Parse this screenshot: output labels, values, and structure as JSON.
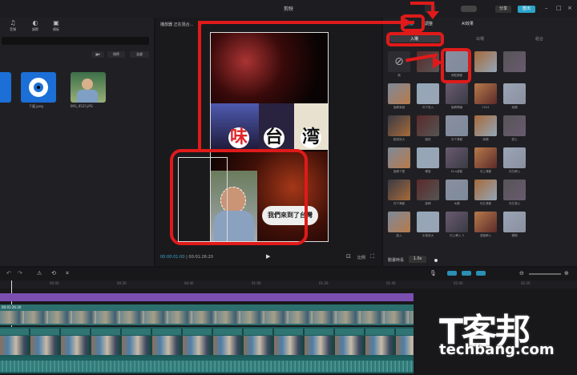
{
  "window": {
    "title": "剪映"
  },
  "left_tabs": [
    {
      "label": "音頻",
      "icon": "audio-icon"
    },
    {
      "label": "調節",
      "icon": "adjust-icon"
    },
    {
      "label": "模板",
      "icon": "template-icon"
    }
  ],
  "filter_buttons": {
    "sort": "排序",
    "all": "全部"
  },
  "media": [
    {
      "label": "下載.jpeg",
      "color": "#1b6fd6"
    },
    {
      "label": "IMG_9525.JPG",
      "color": "#6b8c4a"
    }
  ],
  "player": {
    "label": "播放器 正在混合...",
    "timecode_current": "00:00:01:00",
    "timecode_total": "00:01:26:20"
  },
  "video": {
    "chars": [
      "味",
      "台",
      "湾"
    ],
    "caption": "我們來到了台灣"
  },
  "right_panel": {
    "tabs": [
      {
        "label": "動畫"
      },
      {
        "label": "調整"
      },
      {
        "label": "AI效果"
      }
    ],
    "subtabs": [
      "入場",
      "出場",
      "組合"
    ],
    "active_subtab": "入場",
    "effects": [
      {
        "label": "無"
      },
      {
        "label": ""
      },
      {
        "label": "雨點擴散"
      },
      {
        "label": ""
      },
      {
        "label": ""
      },
      {
        "label": "旋轉漸變"
      },
      {
        "label": "向下甩入"
      },
      {
        "label": "旋轉開幕"
      },
      {
        "label": "2024"
      },
      {
        "label": "漸顯"
      },
      {
        "label": "動感放大"
      },
      {
        "label": "縮放"
      },
      {
        "label": "向下滑動"
      },
      {
        "label": "漸顯"
      },
      {
        "label": "愛心"
      },
      {
        "label": "旋轉下墜"
      },
      {
        "label": "螺旋"
      },
      {
        "label": "Kira游動"
      },
      {
        "label": "向上滑動"
      },
      {
        "label": "向左轉入"
      },
      {
        "label": "向下滑動"
      },
      {
        "label": "旋轉"
      },
      {
        "label": "木翻"
      },
      {
        "label": "向左滑動"
      },
      {
        "label": "向左愛心"
      },
      {
        "label": "旋入"
      },
      {
        "label": "步進放大"
      },
      {
        "label": "向上轉入 II"
      },
      {
        "label": "迴旋轉入"
      },
      {
        "label": "模糊"
      }
    ],
    "duration_label": "動畫時長",
    "duration_value": "1.0s"
  },
  "timeline": {
    "ruler": [
      "00:00",
      "00:20",
      "00:40",
      "01:00",
      "01:20",
      "01:40",
      "02:00",
      "02:20",
      "02:40"
    ],
    "main_clip_label": "00:01:26:20"
  },
  "watermark": {
    "brand": "T客邦",
    "site": "techbang.com"
  }
}
